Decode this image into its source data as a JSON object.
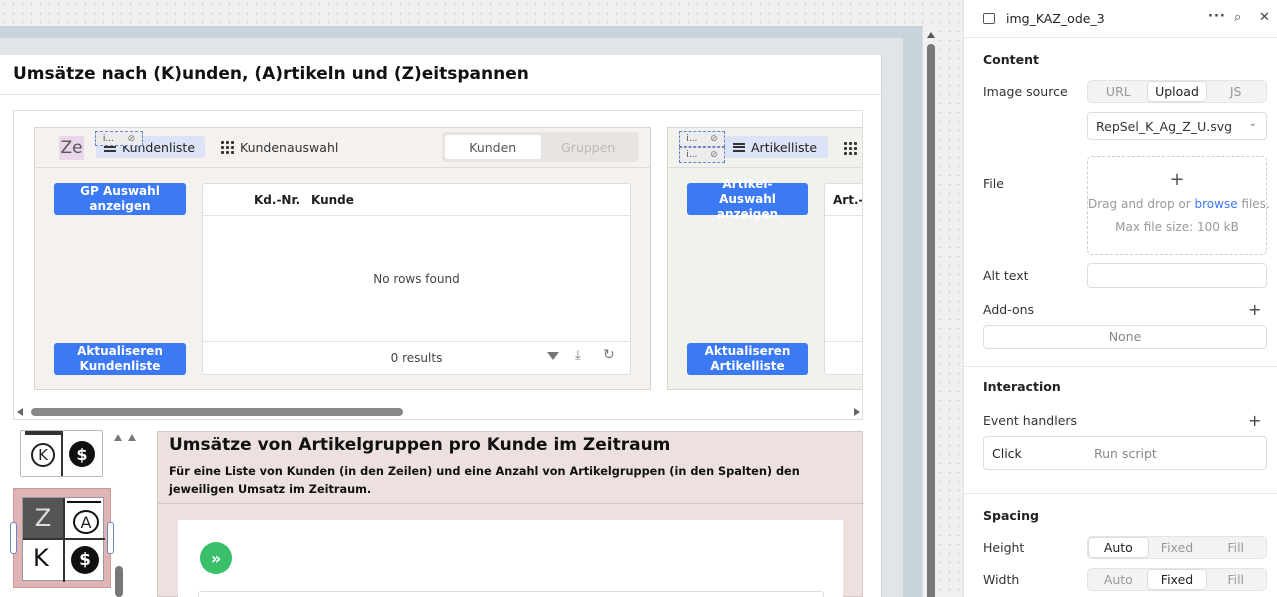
{
  "canvas": {
    "page_title": "Umsätze nach (K)unden, (A)rtikeln und (Z)eitspannen",
    "kunden_panel": {
      "logo_text": "Ze",
      "hidden_badge": "i...",
      "tab_list": "Kundenliste",
      "tab_select": "Kundenauswahl",
      "seg_a": "Kunden",
      "seg_b": "Gruppen",
      "btn_show": "GP Auswahl anzeigen",
      "btn_refresh": "Aktualiseren Kundenliste",
      "col1": "Kd.-Nr.",
      "col2": "Kunde",
      "empty": "No rows found",
      "results": "0 results"
    },
    "artikel_panel": {
      "hidden_badge_1": "i...",
      "hidden_badge_2": "i...",
      "tab_list": "Artikelliste",
      "btn_show": "Artikel-Auswahl anzeigen",
      "btn_refresh": "Aktualiseren Artikelliste",
      "col1": "Art.-..."
    },
    "thumbs": {
      "z": "Z",
      "a": "A",
      "k": "K",
      "dollar": "$"
    },
    "section": {
      "title": "Umsätze von Artikelgruppen pro Kunde im Zeitraum",
      "desc": "Für eine Liste von Kunden (in den Zeilen) und eine Anzahl von Artikelgruppen (in den Spalten) den jeweiligen Umsatz im Zeitraum."
    }
  },
  "inspector": {
    "component_name": "img_KAZ_ode_3",
    "content_title": "Content",
    "image_source_label": "Image source",
    "image_source_options": [
      "URL",
      "Upload",
      "JS"
    ],
    "image_source_selected": "Upload",
    "file_select_value": "RepSel_K_Ag_Z_U.svg",
    "file_label": "File",
    "drop_plus": "+",
    "drop_text_pre": "Drag and drop or ",
    "drop_link": "browse",
    "drop_text_post": " files.",
    "drop_max": "Max file size: 100 kB",
    "alt_text_label": "Alt text",
    "alt_text_value": "",
    "addons_label": "Add-ons",
    "addons_value": "None",
    "interaction_title": "Interaction",
    "event_handlers_label": "Event handlers",
    "event_name": "Click",
    "event_action": "Run script",
    "spacing_title": "Spacing",
    "height_label": "Height",
    "height_options": [
      "Auto",
      "Fixed",
      "Fill"
    ],
    "width_label": "Width",
    "width_options": [
      "Auto",
      "Fixed",
      "Fill"
    ]
  },
  "colors": {
    "accent": "#3c79f5",
    "panel_bg": "#f4f1ef",
    "section_bg": "#ede1df",
    "frame_bg": "#c8d3da"
  }
}
